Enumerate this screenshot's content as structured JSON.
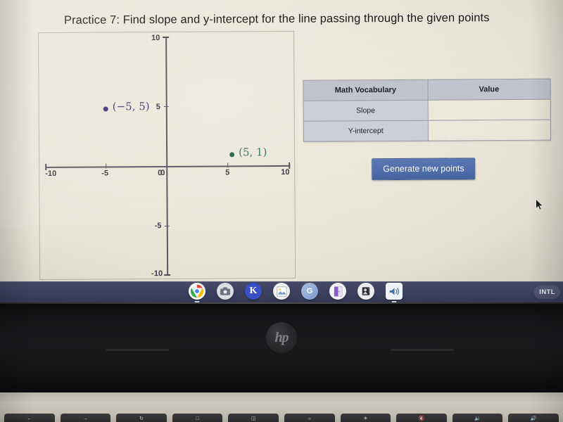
{
  "worksheet": {
    "title": "Practice 7: Find slope and y-intercept for the line passing through the given points"
  },
  "chart_data": {
    "type": "scatter",
    "title": "",
    "xlabel": "",
    "ylabel": "",
    "xlim": [
      -10,
      10
    ],
    "ylim": [
      -10,
      10
    ],
    "grid": false,
    "x_ticks": [
      "-10",
      "-5",
      "0",
      "5",
      "10"
    ],
    "y_ticks": [
      "10",
      "5",
      "0",
      "-5",
      "-10"
    ],
    "legend": "none",
    "points": [
      {
        "label": "(−5, 5)",
        "x": -5,
        "y": 5,
        "color": "#463c82"
      },
      {
        "label": "(5, 1)",
        "x": 5,
        "y": 1,
        "color": "#2f6b4f"
      }
    ]
  },
  "table": {
    "headers": [
      "Math Vocabulary",
      "Value"
    ],
    "rows": [
      {
        "vocab": "Slope",
        "value": ""
      },
      {
        "vocab": "Y-intercept",
        "value": ""
      }
    ]
  },
  "controls": {
    "generate_button": "Generate new points"
  },
  "shelf": {
    "apps": [
      {
        "name": "chrome-icon",
        "glyph": "",
        "bg": "#ffffff",
        "fg": "#4285f4",
        "running": true,
        "shape": "circle"
      },
      {
        "name": "camera-icon",
        "glyph": "■",
        "bg": "#e8e8ea",
        "fg": "#5f6673",
        "running": false,
        "shape": "circle"
      },
      {
        "name": "kami-icon",
        "glyph": "K",
        "bg": "#3b4fc4",
        "fg": "#ffffff",
        "running": false,
        "shape": "circle"
      },
      {
        "name": "photos-icon",
        "glyph": "❀",
        "bg": "#f1f1f3",
        "fg": "#6b8fb8",
        "running": false,
        "shape": "circle"
      },
      {
        "name": "google-classroom-icon",
        "glyph": "G",
        "bg": "#8fa7d8",
        "fg": "#ffffff",
        "running": false,
        "shape": "circle"
      },
      {
        "name": "notebook-app-icon",
        "glyph": "▌",
        "bg": "#f2f1f5",
        "fg": "#7b4fc0",
        "running": false,
        "shape": "circle"
      },
      {
        "name": "media-app-icon",
        "glyph": "▣",
        "bg": "#ededef",
        "fg": "#2a2a30",
        "running": false,
        "shape": "circle"
      },
      {
        "name": "speaker-app-icon",
        "glyph": "▶",
        "bg": "#eef0f6",
        "fg": "#4a6fae",
        "running": true,
        "shape": "square"
      }
    ],
    "status_label": "INTL"
  },
  "hardware": {
    "brand_logo": "hp"
  }
}
